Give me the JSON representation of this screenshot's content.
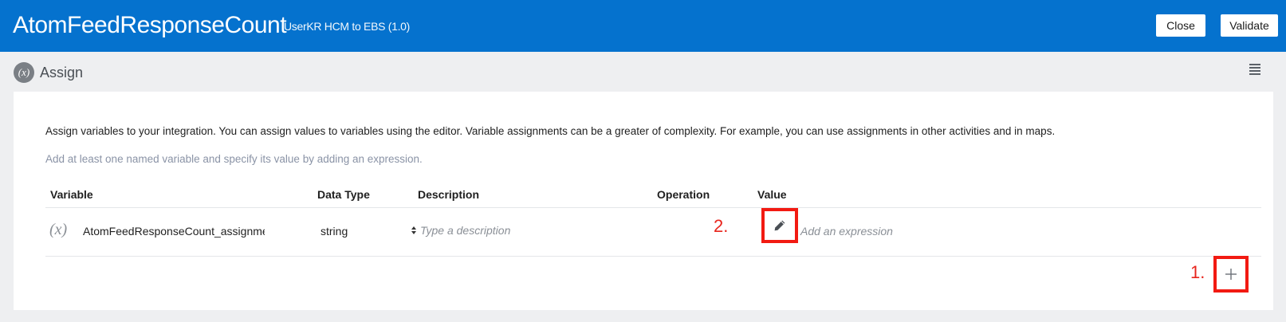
{
  "header": {
    "title": "AtomFeedResponseCount",
    "subtitle": "UserKR HCM to EBS (1.0)",
    "close_label": "Close",
    "validate_label": "Validate",
    "background_color": "#0572ce"
  },
  "subheader": {
    "icon_text": "(x)",
    "title": "Assign",
    "menu_icon": "hamburger-icon"
  },
  "panel": {
    "intro": "Assign variables to your integration. You can assign values to variables using the editor. Variable assignments can be a greater of complexity. For example, you can use assignments in other activities and in maps.",
    "hint": "Add at least one named variable and specify its value by adding an expression."
  },
  "table": {
    "columns": [
      "Variable",
      "Data Type",
      "Description",
      "Operation",
      "Value"
    ],
    "rows": [
      {
        "icon_text": "(x)",
        "variable": "AtomFeedResponseCount_assignme",
        "data_type": "string",
        "description_placeholder": "Type a description",
        "operation": "",
        "value_placeholder": "Add an expression"
      }
    ]
  },
  "annotations": {
    "step1": "1.",
    "step2": "2.",
    "color": "#e8251d"
  },
  "icons": {
    "edit": "pencil-icon",
    "add": "plus-icon"
  }
}
